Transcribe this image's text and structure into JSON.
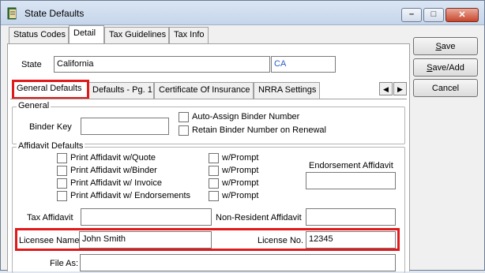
{
  "window": {
    "title": "State Defaults",
    "min_glyph": "–",
    "max_glyph": "□",
    "close_glyph": "✕"
  },
  "top_tabs": [
    "Status Codes",
    "Detail",
    "Tax Guidelines",
    "Tax Info"
  ],
  "state": {
    "label": "State",
    "name": "California",
    "code": "CA"
  },
  "sub_tabs": [
    "General Defaults",
    "Defaults - Pg. 1",
    "Certificate Of Insurance",
    "NRRA Settings"
  ],
  "scroll": {
    "left": "◀",
    "right": "▶"
  },
  "general": {
    "legend": "General",
    "binder_key_label": "Binder Key",
    "binder_key_value": "",
    "auto_assign": "Auto-Assign Binder Number",
    "retain": "Retain Binder Number on Renewal"
  },
  "affidavit": {
    "legend": "Affidavit Defaults",
    "print_quote": "Print Affidavit w/Quote",
    "print_binder": "Print Affidavit w/Binder",
    "print_invoice": "Print Affidavit w/ Invoice",
    "print_endorsements": "Print Affidavit w/ Endorsements",
    "prompt": "w/Prompt",
    "endorsement_label": "Endorsement Affidavit",
    "tax_label": "Tax Affidavit",
    "nonresident_label": "Non-Resident Affidavit"
  },
  "licensee": {
    "label": "Licensee Name",
    "value": "John Smith",
    "no_label": "License No.",
    "no_value": "12345"
  },
  "file_as": {
    "label": "File As:",
    "value": ""
  },
  "buttons": {
    "save_a": "S",
    "save_b": "ave",
    "saveadd_a": "S",
    "saveadd_b": "ave/Add",
    "cancel": "Cancel"
  }
}
